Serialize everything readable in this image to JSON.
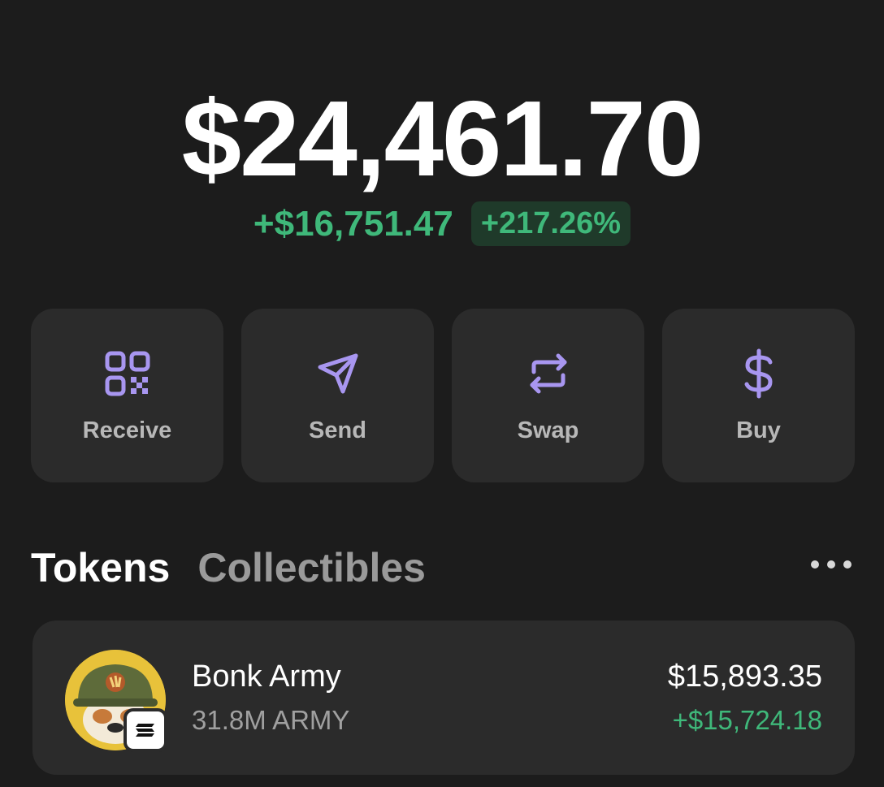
{
  "portfolio": {
    "balance": "$24,461.70",
    "change_amount": "+$16,751.47",
    "change_percent": "+217.26%"
  },
  "colors": {
    "accent": "#a896f0",
    "positive": "#3fb87a",
    "card": "#2b2b2b",
    "background": "#1c1c1c"
  },
  "actions": [
    {
      "label": "Receive",
      "icon": "qr-code-icon"
    },
    {
      "label": "Send",
      "icon": "send-arrow-icon"
    },
    {
      "label": "Swap",
      "icon": "swap-arrows-icon"
    },
    {
      "label": "Buy",
      "icon": "dollar-icon"
    }
  ],
  "tabs": {
    "tokens": "Tokens",
    "collectibles": "Collectibles",
    "active": "Tokens"
  },
  "tokens": [
    {
      "name": "Bonk Army",
      "amount": "31.8M ARMY",
      "value": "$15,893.35",
      "change": "+$15,724.18",
      "icon": "bonk-army-avatar",
      "chain_icon": "solana-badge-icon"
    }
  ]
}
